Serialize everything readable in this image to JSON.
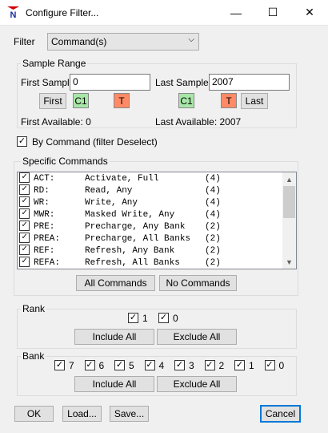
{
  "window": {
    "title": "Configure Filter...",
    "minimize": "—",
    "maximize": "☐",
    "close": "✕"
  },
  "filter": {
    "label": "Filter",
    "value": "Command(s)"
  },
  "sample_range": {
    "group_label": "Sample Range",
    "first_label": "First Sample",
    "first_value": "0",
    "last_label": "Last Sample",
    "last_value": "2007",
    "first_button": "First",
    "last_button": "Last",
    "c1": "C1",
    "t": "T",
    "first_available": "First Available: 0",
    "last_available": "Last Available: 2007"
  },
  "by_command": {
    "label": "By Command (filter Deselect)",
    "checked": true
  },
  "specific_commands": {
    "group_label": "Specific Commands",
    "rows": [
      {
        "code": "ACT:",
        "desc": "Activate, Full",
        "count": "(4)"
      },
      {
        "code": "RD:",
        "desc": "Read, Any",
        "count": "(4)"
      },
      {
        "code": "WR:",
        "desc": "Write, Any",
        "count": "(4)"
      },
      {
        "code": "MWR:",
        "desc": "Masked Write, Any",
        "count": "(4)"
      },
      {
        "code": "PRE:",
        "desc": "Precharge, Any Bank",
        "count": "(2)"
      },
      {
        "code": "PREA:",
        "desc": "Precharge, All Banks",
        "count": "(2)"
      },
      {
        "code": "REF:",
        "desc": "Refresh, Any Bank",
        "count": "(2)"
      },
      {
        "code": "REFA:",
        "desc": "Refresh, All Banks",
        "count": "(2)"
      }
    ],
    "all_button": "All Commands",
    "none_button": "No Commands"
  },
  "rank": {
    "group_label": "Rank",
    "items": [
      "1",
      "0"
    ],
    "include_all": "Include All",
    "exclude_all": "Exclude All"
  },
  "bank": {
    "group_label": "Bank",
    "items": [
      "7",
      "6",
      "5",
      "4",
      "3",
      "2",
      "1",
      "0"
    ],
    "include_all": "Include All",
    "exclude_all": "Exclude All"
  },
  "footer": {
    "ok": "OK",
    "load": "Load...",
    "save": "Save...",
    "cancel": "Cancel"
  },
  "colors": {
    "c1": "#a8e6a8",
    "t": "#ff8a65",
    "accent": "#0078d7"
  },
  "check_glyph": "✓"
}
